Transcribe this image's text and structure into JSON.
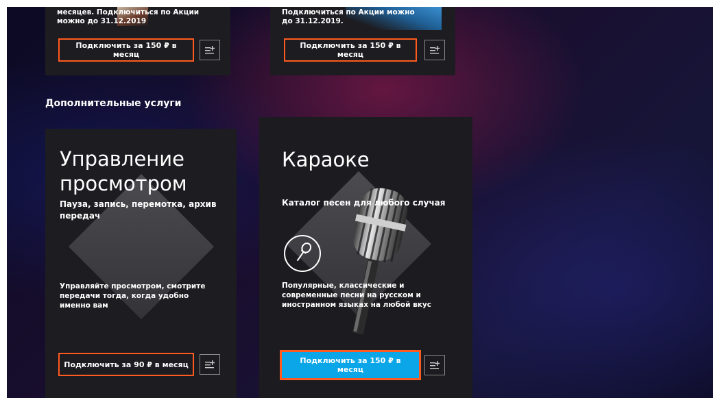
{
  "top_cards": [
    {
      "description": "месяцев. Подключиться по Акции можно до 31.12.2019",
      "button_label": "Подключить за 150 ₽ в месяц"
    },
    {
      "description": "Подключиться по Акции можно до 31.12.2019.",
      "button_label": "Подключить за 150 ₽ в месяц"
    }
  ],
  "section_title": "Дополнительные услуги",
  "services": [
    {
      "title": "Управление просмотром",
      "subtitle": "Пауза, запись, перемотка, архив передач",
      "description": "Управляйте просмотром, смотрите передачи тогда, когда удобно именно вам",
      "button_label": "Подключить за 90 ₽ в месяц"
    },
    {
      "title": "Караоке",
      "subtitle": "Каталог песен для любого случая",
      "description": "Популярные, классические и современные песни на русском и иностранном языках на любой вкус",
      "button_label": "Подключить за 150 ₽ в месяц"
    }
  ],
  "icons": {
    "details": "list-add-icon",
    "karaoke": "microphone-icon"
  },
  "colors": {
    "accent_border": "#ff5a1f",
    "primary_button": "#0aa6e8",
    "card_bg": "#1d1c20"
  }
}
